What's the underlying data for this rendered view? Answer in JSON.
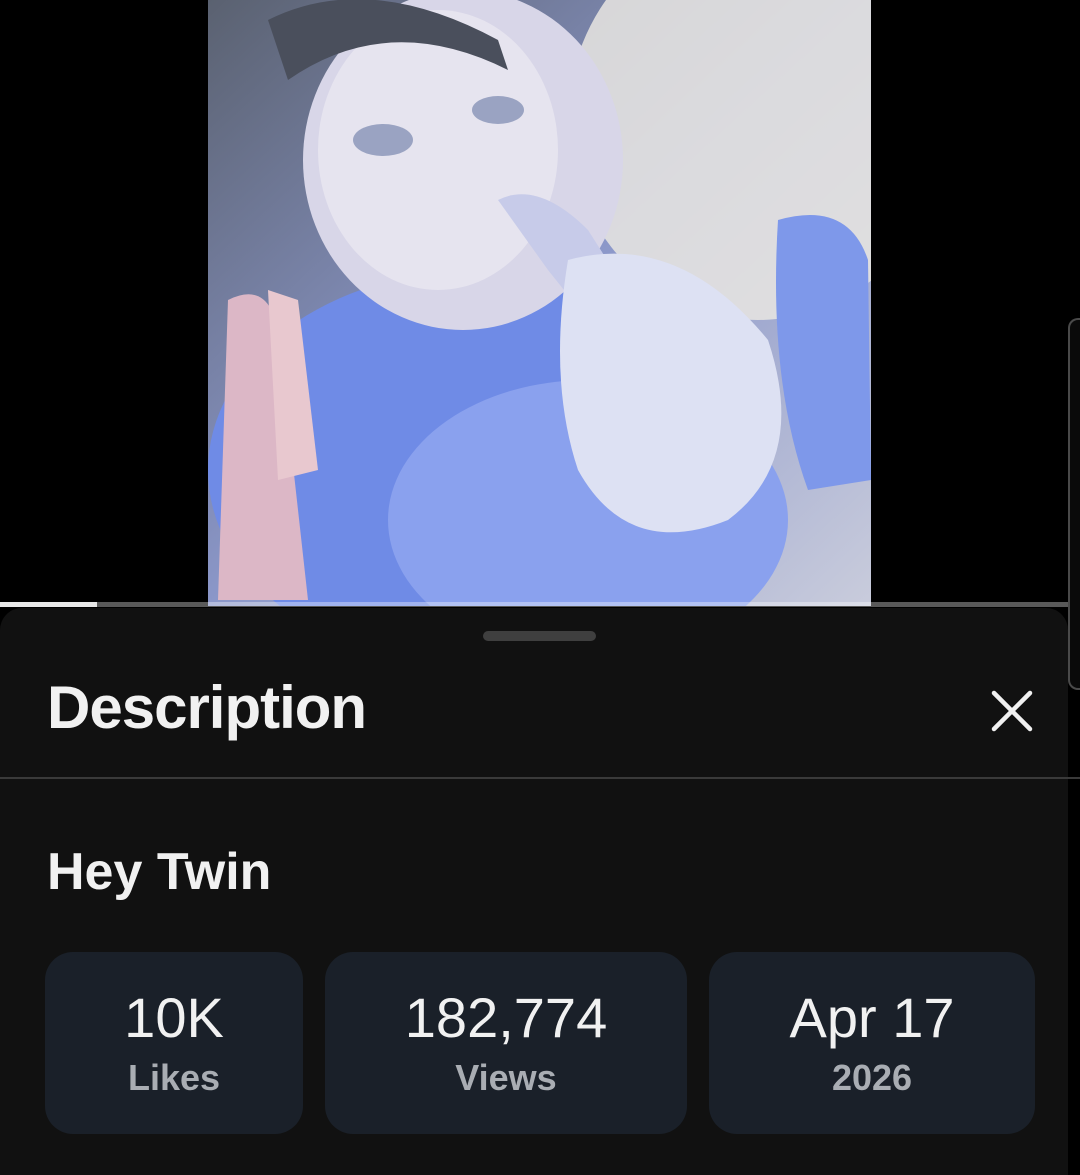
{
  "player": {
    "progress_fraction": 0.09
  },
  "description_sheet": {
    "title": "Description",
    "close_icon": "close-icon",
    "video_title": "Hey Twin",
    "stats": [
      {
        "value": "10K",
        "label": "Likes"
      },
      {
        "value": "182,774",
        "label": "Views"
      },
      {
        "value": "Apr 17",
        "label": "2026"
      }
    ]
  },
  "colors": {
    "sheet_background": "#111111",
    "stat_background": "#1a2029",
    "primary_text": "#f1f1f1",
    "secondary_text": "#a9adb3"
  }
}
